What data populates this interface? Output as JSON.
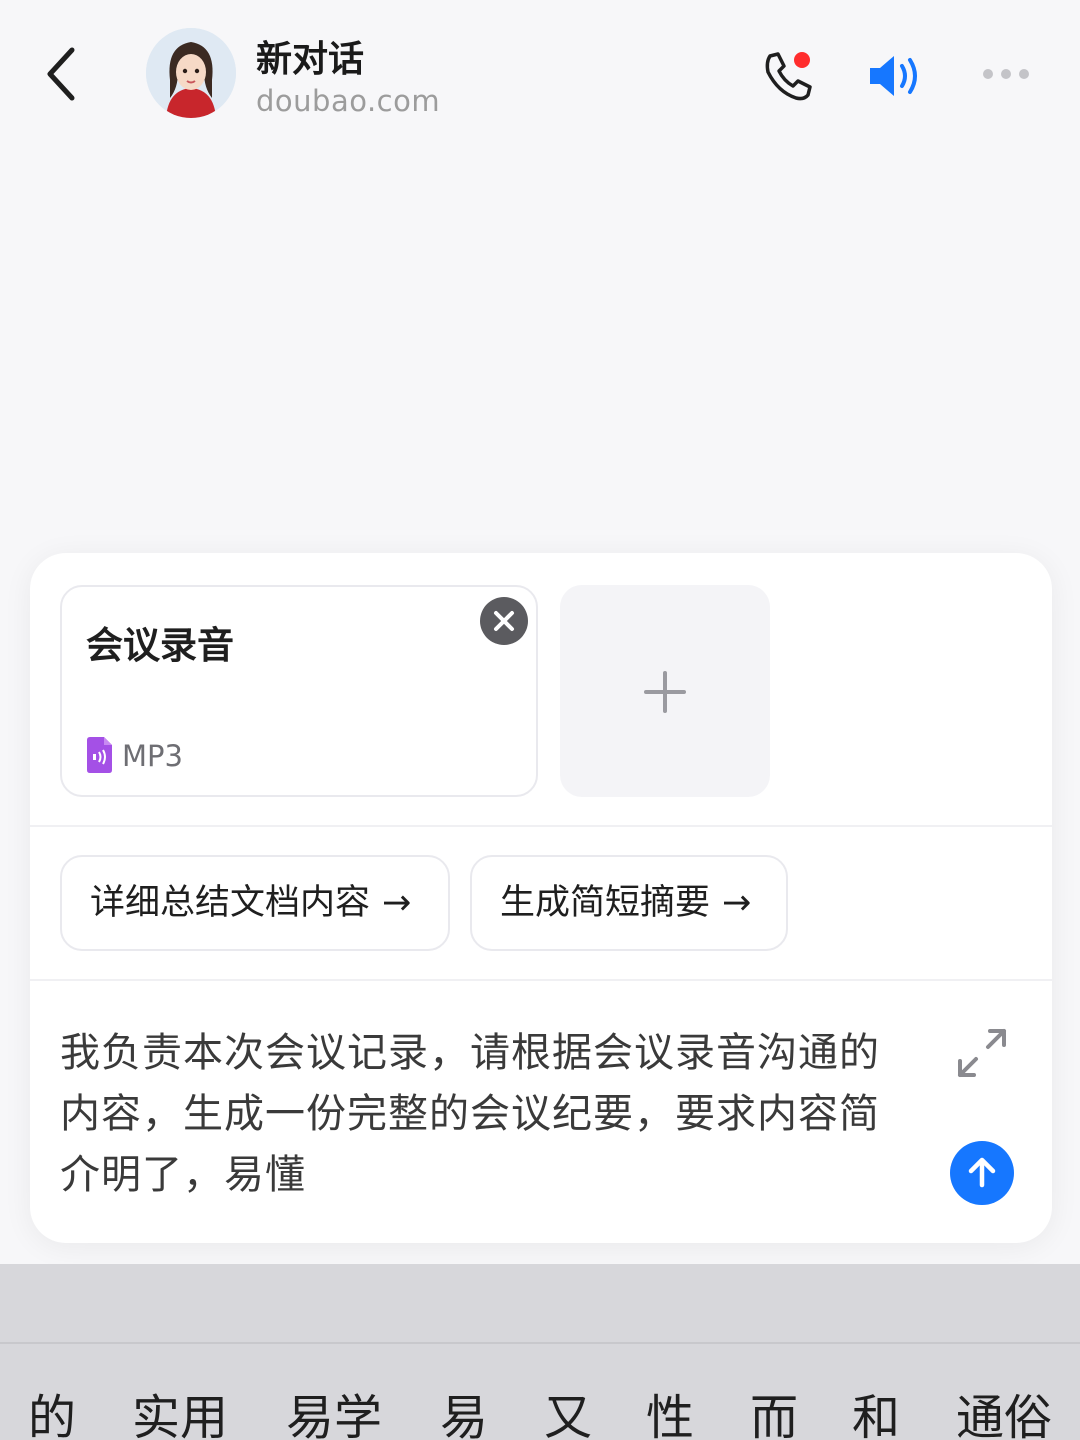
{
  "header": {
    "title": "新对话",
    "subtitle": "doubao.com",
    "icons": [
      "back-icon",
      "avatar",
      "phone-call-icon",
      "speaker-icon",
      "more-icon"
    ]
  },
  "attachments": [
    {
      "name": "会议录音",
      "type": "MP3"
    }
  ],
  "suggestions": [
    {
      "label": "详细总结文档内容",
      "arrow": "→"
    },
    {
      "label": "生成简短摘要",
      "arrow": "→"
    }
  ],
  "composer": {
    "text": "我负责本次会议记录，请根据会议录音沟通的内容，生成一份完整的会议纪要，要求内容简介明了，易懂"
  },
  "keyboard": {
    "candidates": [
      "的",
      "实用",
      "易学",
      "易",
      "又",
      "性",
      "而",
      "和",
      "通俗"
    ]
  },
  "colors": {
    "accent": "#1677ff",
    "notification_dot": "#ff2d2d",
    "file_icon": "#a450e6"
  }
}
